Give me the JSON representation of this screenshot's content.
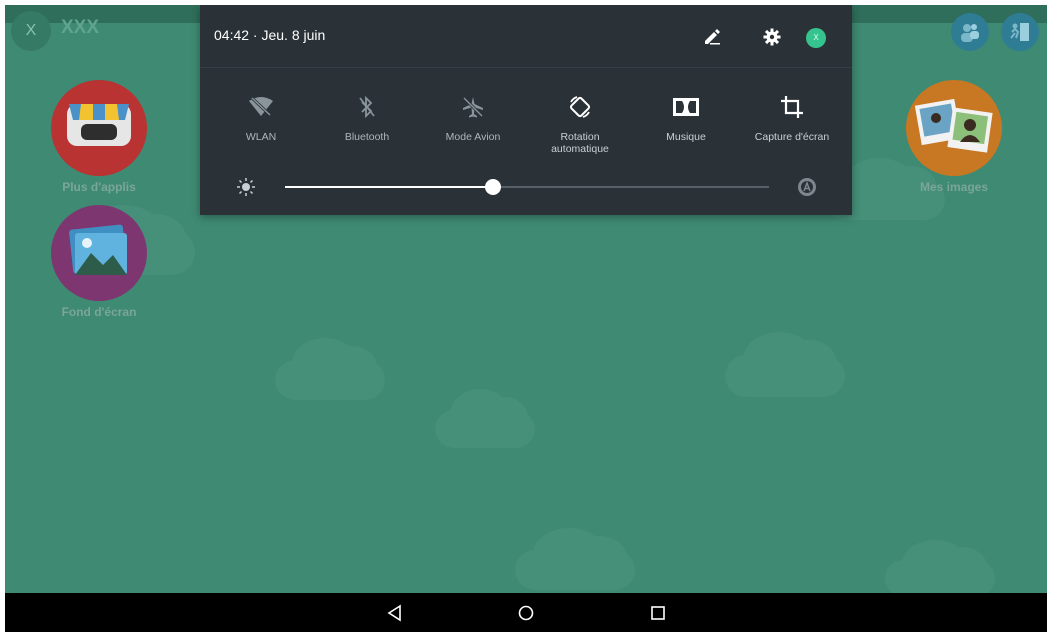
{
  "status": {
    "time_date": "04:42 · Jeu. 8 juin"
  },
  "launcher": {
    "user_initial": "X",
    "user_name": "XXX",
    "apps": [
      {
        "label": "Plus d'applis",
        "icon": "store-icon",
        "color": "#c6322f"
      },
      {
        "label": "Fond d'écran",
        "icon": "wallpaper-icon",
        "color": "#8a3a78"
      },
      {
        "label": "Mes images",
        "icon": "photos-icon",
        "color": "#e07a1e"
      }
    ]
  },
  "quick_settings": {
    "avatar_initial": "X",
    "tiles": [
      {
        "label": "WLAN",
        "icon": "wifi-off-icon",
        "active": false
      },
      {
        "label": "Bluetooth",
        "icon": "bluetooth-off-icon",
        "active": false
      },
      {
        "label": "Mode Avion",
        "icon": "airplane-icon",
        "active": false
      },
      {
        "label": "Rotation automatique",
        "icon": "auto-rotate-icon",
        "active": true
      },
      {
        "label": "Musique",
        "icon": "dolby-icon",
        "active": true
      },
      {
        "label": "Capture d'écran",
        "icon": "crop-icon",
        "active": true
      }
    ],
    "brightness_fraction": 0.43
  },
  "colors": {
    "shade_bg": "#2a3238",
    "wallpaper": "#3f8a73",
    "accent_green": "#35c48e"
  }
}
